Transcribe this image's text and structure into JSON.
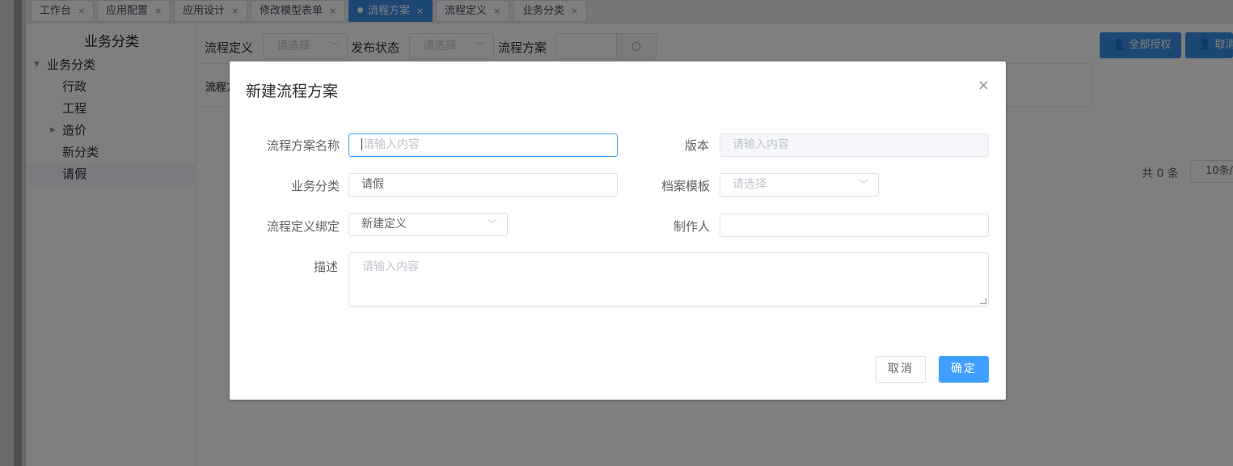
{
  "tabs": [
    {
      "label": "工作台",
      "close": "×"
    },
    {
      "label": "应用配置",
      "close": "×"
    },
    {
      "label": "应用设计",
      "close": "×"
    },
    {
      "label": "修改模型表单",
      "close": "×"
    },
    {
      "label": "流程方案",
      "close": "×",
      "active": true
    },
    {
      "label": "流程定义",
      "close": "×"
    },
    {
      "label": "业务分类",
      "close": "×"
    }
  ],
  "sidebar": {
    "title": "业务分类",
    "tree": {
      "root": "业务分类",
      "children": [
        "行政",
        "工程",
        "造价",
        "新分类",
        "请假"
      ],
      "selected": "请假"
    }
  },
  "filters": {
    "definition_label": "流程定义",
    "definition_placeholder": "请选择",
    "status_label": "发布状态",
    "status_placeholder": "请选择",
    "scheme_label": "流程方案"
  },
  "actions": {
    "authorize_all": "全部授权",
    "cancel_auth": "取消"
  },
  "table": {
    "first_header": "流程方"
  },
  "pagination": {
    "total": "共 0 条",
    "page_size": "10条/"
  },
  "dialog": {
    "title": "新建流程方案",
    "close": "×",
    "fields": {
      "scheme_name_label": "流程方案名称",
      "scheme_name_placeholder": "请输入内容",
      "version_label": "版本",
      "version_placeholder": "请输入内容",
      "category_label": "业务分类",
      "category_value": "请假",
      "template_label": "档案模板",
      "template_placeholder": "请选择",
      "definition_label": "流程定义绑定",
      "definition_value": "新建定义",
      "creator_label": "制作人",
      "creator_value": "",
      "description_label": "描述",
      "description_placeholder": "请输入内容"
    },
    "buttons": {
      "cancel": "取消",
      "confirm": "确定"
    }
  },
  "colors": {
    "primary": "#409eff",
    "active_tab": "#3a8ee6",
    "mask": "rgba(0,0,0,0.5)"
  }
}
